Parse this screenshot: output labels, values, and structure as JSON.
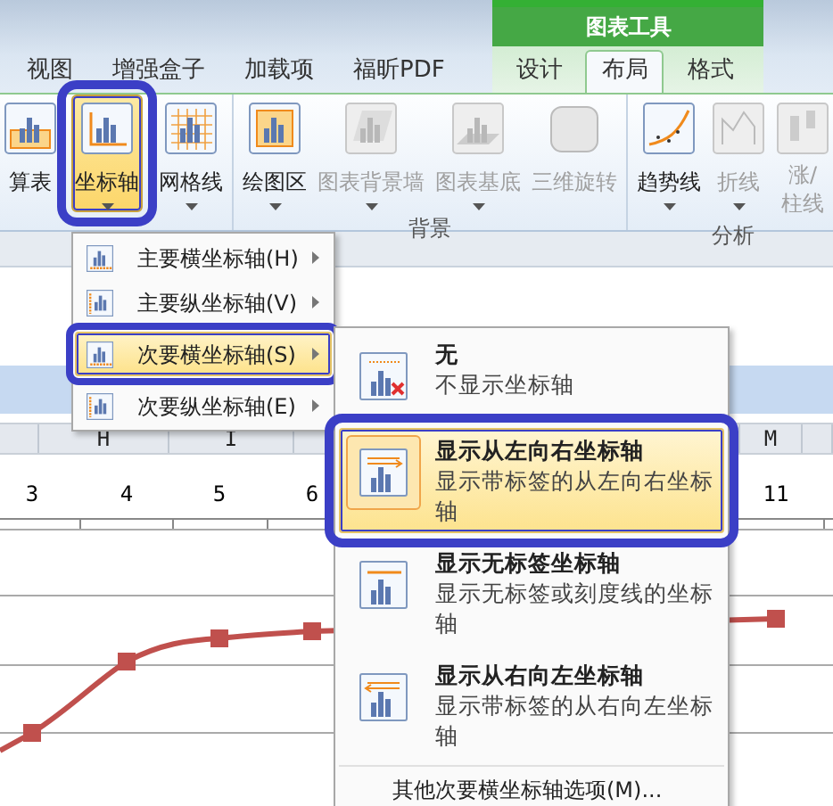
{
  "tabs": [
    {
      "label": "视图",
      "selected": false
    },
    {
      "label": "增强盒子",
      "selected": false
    },
    {
      "label": "加载项",
      "selected": false
    },
    {
      "label": "福昕PDF",
      "selected": false
    }
  ],
  "context_group": {
    "title": "图表工具",
    "tabs": [
      {
        "label": "设计",
        "selected": false
      },
      {
        "label": "布局",
        "selected": true
      },
      {
        "label": "格式",
        "selected": false
      }
    ]
  },
  "ribbon_groups": [
    {
      "buttons": [
        {
          "label": "算表",
          "kind": "table",
          "disabled": false,
          "pressed": false,
          "highlighted": false,
          "dropdown": false
        },
        {
          "label": "坐标轴",
          "kind": "axis",
          "disabled": false,
          "pressed": true,
          "highlighted": true,
          "dropdown": true
        },
        {
          "label": "网格线",
          "kind": "gridlines",
          "disabled": false,
          "pressed": false,
          "highlighted": false,
          "dropdown": true
        }
      ]
    },
    {
      "label": "背景",
      "buttons": [
        {
          "label": "绘图区",
          "kind": "plot-area",
          "disabled": false,
          "pressed": false,
          "highlighted": false,
          "dropdown": true
        },
        {
          "label": "图表背景墙",
          "kind": "wall",
          "disabled": true,
          "pressed": false,
          "highlighted": false,
          "dropdown": true
        },
        {
          "label": "图表基底",
          "kind": "floor",
          "disabled": true,
          "pressed": false,
          "highlighted": false,
          "dropdown": true
        },
        {
          "label": "三维旋转",
          "kind": "rotate",
          "disabled": true,
          "pressed": false,
          "highlighted": false,
          "dropdown": false
        }
      ]
    },
    {
      "label": "分析",
      "buttons": [
        {
          "label": "趋势线",
          "kind": "trendline",
          "disabled": false,
          "pressed": false,
          "highlighted": false,
          "dropdown": true
        },
        {
          "label": "折线",
          "kind": "lines",
          "disabled": true,
          "pressed": false,
          "highlighted": false,
          "dropdown": true
        },
        {
          "label": "涨/柱线",
          "kind": "updown",
          "disabled": true,
          "pressed": false,
          "highlighted": false,
          "dropdown": false
        }
      ]
    }
  ],
  "columns": [
    {
      "label": "H"
    },
    {
      "label": "I"
    },
    {
      "label": "M"
    }
  ],
  "chart": {
    "x_labels": [
      "3",
      "4",
      "5",
      "6",
      "11"
    ]
  },
  "axis_menu": {
    "items": [
      {
        "label": "主要横坐标轴(H)",
        "kind": "horizontal",
        "selected": false,
        "highlighted": false
      },
      {
        "label": "主要纵坐标轴(V)",
        "kind": "vertical",
        "selected": false,
        "highlighted": false
      },
      {
        "label": "次要横坐标轴(S)",
        "kind": "horizontal",
        "selected": true,
        "highlighted": true
      },
      {
        "label": "次要纵坐标轴(E)",
        "kind": "vertical",
        "selected": false,
        "highlighted": false
      }
    ]
  },
  "submenu": {
    "items": [
      {
        "title": "无",
        "description": "不显示坐标轴",
        "kind": "none",
        "selected": false,
        "highlighted": false
      },
      {
        "title": "显示从左向右坐标轴",
        "description": "显示带标签的从左向右坐标轴",
        "kind": "left-to-right",
        "selected": true,
        "highlighted": true
      },
      {
        "title": "显示无标签坐标轴",
        "description": "显示无标签或刻度线的坐标轴",
        "kind": "no-labels",
        "selected": false,
        "highlighted": false
      },
      {
        "title": "显示从右向左坐标轴",
        "description": "显示带标签的从右向左坐标轴",
        "kind": "right-to-left",
        "selected": false,
        "highlighted": false
      }
    ],
    "footer": "其他次要横坐标轴选项(M)..."
  }
}
